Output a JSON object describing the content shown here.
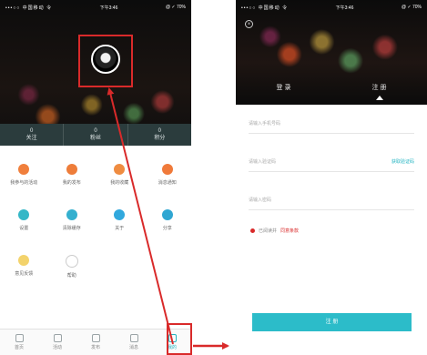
{
  "left": {
    "status": {
      "carrier": "•••○○ 中国移动 令",
      "time": "下午3:46",
      "battery": "@ ✓ 70%"
    },
    "stats": [
      {
        "num": "0",
        "label": "关注"
      },
      {
        "num": "0",
        "label": "粉丝"
      },
      {
        "num": "0",
        "label": "积分"
      }
    ],
    "grid": [
      {
        "label": "我参与的活动",
        "color": "#f07f3c"
      },
      {
        "label": "我的发布",
        "color": "#ee7d3a"
      },
      {
        "label": "我的收藏",
        "color": "#ef8c41"
      },
      {
        "label": "消息通知",
        "color": "#f07a3a"
      },
      {
        "label": "设置",
        "color": "#35b7c7"
      },
      {
        "label": "清除缓存",
        "color": "#34b0cf"
      },
      {
        "label": "关于",
        "color": "#31a8dd"
      },
      {
        "label": "分享",
        "color": "#2fa6d2"
      },
      {
        "label": "意见反馈",
        "color": "#f3d36c"
      },
      {
        "label": "帮助",
        "color": "#ffffff"
      }
    ],
    "tabs": [
      {
        "label": "首页"
      },
      {
        "label": "活动"
      },
      {
        "label": "发布"
      },
      {
        "label": "消息"
      },
      {
        "label": "我的"
      }
    ]
  },
  "right": {
    "status": {
      "carrier": "•••○○ 中国移动 令",
      "time": "下午3:46",
      "battery": "@ ✓ 70%"
    },
    "close": "×",
    "auth_tabs": [
      "登 录",
      "注 册"
    ],
    "fields": [
      {
        "placeholder": "请输入手机号码",
        "action": ""
      },
      {
        "placeholder": "请输入验证码",
        "action": "获取验证码"
      },
      {
        "placeholder": "请输入密码",
        "action": ""
      }
    ],
    "agree_text": "已阅读并",
    "agree_link": "同意条款",
    "submit": "注 册"
  }
}
